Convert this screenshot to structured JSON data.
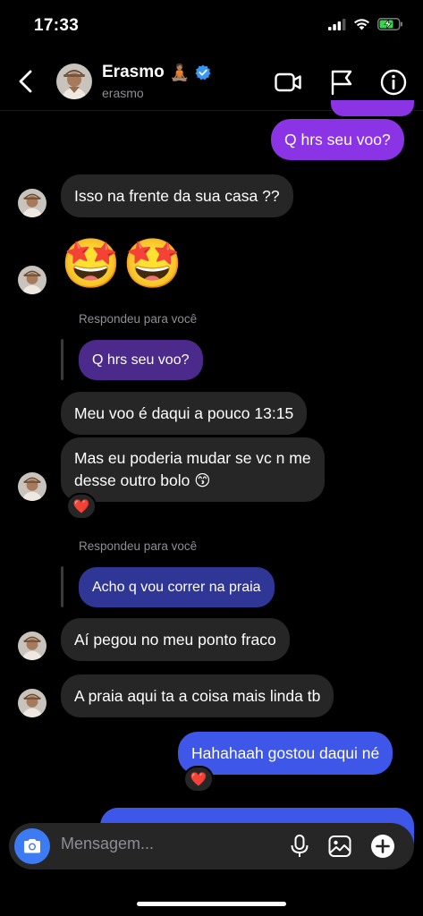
{
  "status": {
    "time": "17:33"
  },
  "header": {
    "name": "Erasmo",
    "name_emoji": "🧘🏽",
    "username": "erasmo"
  },
  "messages": {
    "m1": "Q hrs seu voo?",
    "m2": "Isso na frente da sua casa ??",
    "m3": "🤩🤩",
    "reply1_label": "Respondeu para você",
    "reply1_quote": "Q hrs seu voo?",
    "m4": "Meu voo é daqui a pouco 13:15",
    "m5_line1": "Mas eu poderia mudar se vc n me",
    "m5_line2": "desse outro bolo 😙",
    "m5_reaction": "❤️",
    "reply2_label": "Respondeu para você",
    "reply2_quote": "Acho q vou correr na praia",
    "m6": "Aí pegou no meu ponto fraco",
    "m7": "A praia aqui ta a coisa mais linda tb",
    "m8": "Hahahaah gostou daqui né",
    "m8_reaction": "❤️"
  },
  "composer": {
    "placeholder": "Mensagem..."
  },
  "colors": {
    "purple_bubble": "#8a34e6",
    "blue_bubble": "#3e57e8",
    "incoming_bubble": "#262626",
    "camera": "#3d7bf5"
  },
  "icons": [
    "back-arrow-icon",
    "verified-badge-icon",
    "video-camera-icon",
    "flag-icon",
    "info-icon",
    "camera-icon",
    "microphone-icon",
    "gallery-icon",
    "plus-icon"
  ]
}
